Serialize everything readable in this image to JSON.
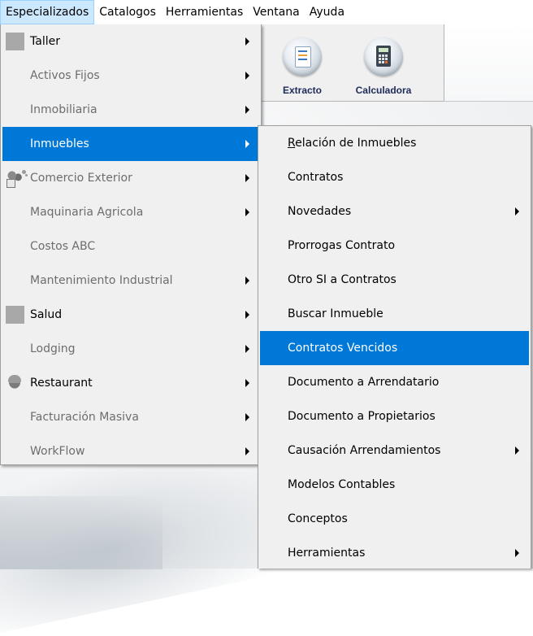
{
  "menubar": {
    "items": [
      {
        "label": "Especializados",
        "active": true
      },
      {
        "label": "Catalogos"
      },
      {
        "label": "Herramientas"
      },
      {
        "label": "Ventana"
      },
      {
        "label": "Ayuda"
      }
    ]
  },
  "toolbar": {
    "buttons": [
      {
        "label": "Extracto",
        "icon": "extracto-icon"
      },
      {
        "label": "Calculadora",
        "icon": "calculator-icon"
      }
    ]
  },
  "especializados_menu": {
    "items": [
      {
        "label": "Taller",
        "icon": "gray-square-icon",
        "submenu": true
      },
      {
        "label": "Activos Fijos",
        "submenu": true
      },
      {
        "label": "Inmobiliaria",
        "submenu": true
      },
      {
        "label": "Inmuebles",
        "submenu": true,
        "selected": true
      },
      {
        "label": "Comercio Exterior",
        "icon": "people-icon",
        "submenu": true
      },
      {
        "label": "Maquinaria Agricola",
        "submenu": true
      },
      {
        "label": "Costos ABC",
        "submenu": false
      },
      {
        "label": "Mantenimiento Industrial",
        "submenu": true
      },
      {
        "label": "Salud",
        "icon": "gray-square-icon",
        "submenu": true
      },
      {
        "label": "Lodging",
        "submenu": true
      },
      {
        "label": "Restaurant",
        "icon": "chef-icon",
        "submenu": true
      },
      {
        "label": "Facturación Masiva",
        "submenu": true
      },
      {
        "label": "WorkFlow",
        "submenu": true
      }
    ]
  },
  "inmuebles_menu": {
    "items": [
      {
        "label": "Relación de Inmuebles",
        "submenu": false
      },
      {
        "label": "Contratos",
        "submenu": false
      },
      {
        "label": "Novedades",
        "submenu": true
      },
      {
        "label": "Prorrogas Contrato",
        "submenu": false
      },
      {
        "label": "Otro SI a Contratos",
        "submenu": false
      },
      {
        "label": "Buscar Inmueble",
        "submenu": false
      },
      {
        "label": "Contratos Vencidos",
        "submenu": false,
        "selected": true
      },
      {
        "label": "Documento a Arrendatario",
        "submenu": false
      },
      {
        "label": "Documento a Propietarios",
        "submenu": false
      },
      {
        "label": "Causación Arrendamientos",
        "submenu": true
      },
      {
        "label": "Modelos Contables",
        "submenu": false
      },
      {
        "label": "Conceptos",
        "submenu": false
      },
      {
        "label": "Herramientas",
        "submenu": true
      }
    ]
  },
  "colors": {
    "selection": "#0078d7",
    "menu_bg": "#f0f0f0",
    "disabled_text": "#6d6d6d",
    "menubar_active": "#cce8ff"
  }
}
